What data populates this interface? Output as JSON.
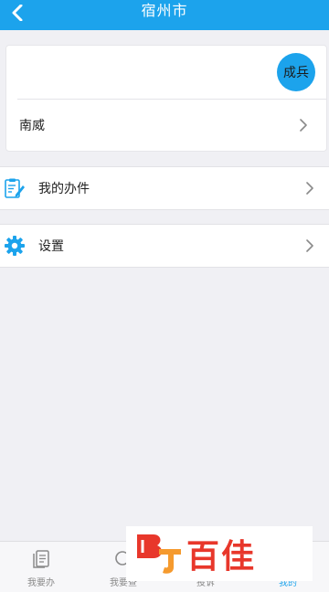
{
  "header": {
    "title": "宿州市"
  },
  "profile": {
    "avatar_text": "成兵",
    "name": "南威"
  },
  "menu": [
    {
      "label": "我的办件",
      "icon": "document-edit-icon"
    },
    {
      "label": "设置",
      "icon": "gear-icon"
    }
  ],
  "tabbar": {
    "tabs": [
      {
        "label": "我要办",
        "icon": "documents-icon",
        "active": false
      },
      {
        "label": "我要查",
        "icon": "search-icon",
        "active": false
      },
      {
        "label": "投诉",
        "icon": "complaint-icon",
        "active": false
      },
      {
        "label": "我的",
        "icon": "user-icon",
        "active": true
      }
    ]
  },
  "watermark": {
    "text": "百佳"
  },
  "colors": {
    "accent": "#1ca3ec",
    "watermark": "#e8372b",
    "background": "#f0f0f4"
  }
}
